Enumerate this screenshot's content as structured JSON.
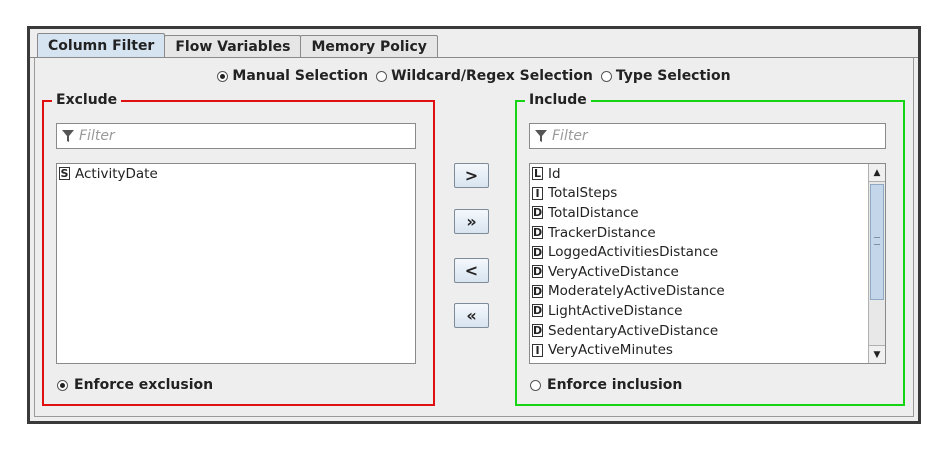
{
  "tabs": [
    {
      "label": "Column Filter",
      "active": true
    },
    {
      "label": "Flow Variables",
      "active": false
    },
    {
      "label": "Memory Policy",
      "active": false
    }
  ],
  "mode": {
    "options": [
      "Manual Selection",
      "Wildcard/Regex Selection",
      "Type Selection"
    ],
    "selected": "Manual Selection"
  },
  "exclude": {
    "title": "Exclude",
    "filter_placeholder": "Filter",
    "items": [
      {
        "type": "S",
        "name": "ActivityDate"
      }
    ],
    "enforce_label": "Enforce exclusion",
    "enforce_selected": true,
    "border_color": "#e01010"
  },
  "include": {
    "title": "Include",
    "filter_placeholder": "Filter",
    "items": [
      {
        "type": "L",
        "name": "Id"
      },
      {
        "type": "I",
        "name": "TotalSteps"
      },
      {
        "type": "D",
        "name": "TotalDistance"
      },
      {
        "type": "D",
        "name": "TrackerDistance"
      },
      {
        "type": "D",
        "name": "LoggedActivitiesDistance"
      },
      {
        "type": "D",
        "name": "VeryActiveDistance"
      },
      {
        "type": "D",
        "name": "ModeratelyActiveDistance"
      },
      {
        "type": "D",
        "name": "LightActiveDistance"
      },
      {
        "type": "D",
        "name": "SedentaryActiveDistance"
      },
      {
        "type": "I",
        "name": "VeryActiveMinutes"
      }
    ],
    "enforce_label": "Enforce inclusion",
    "enforce_selected": false,
    "border_color": "#14d414"
  },
  "move_buttons": [
    {
      "name": "move-right-button",
      "label": ">"
    },
    {
      "name": "move-all-right-button",
      "label": "»"
    },
    {
      "name": "move-left-button",
      "label": "<"
    },
    {
      "name": "move-all-left-button",
      "label": "«"
    }
  ]
}
